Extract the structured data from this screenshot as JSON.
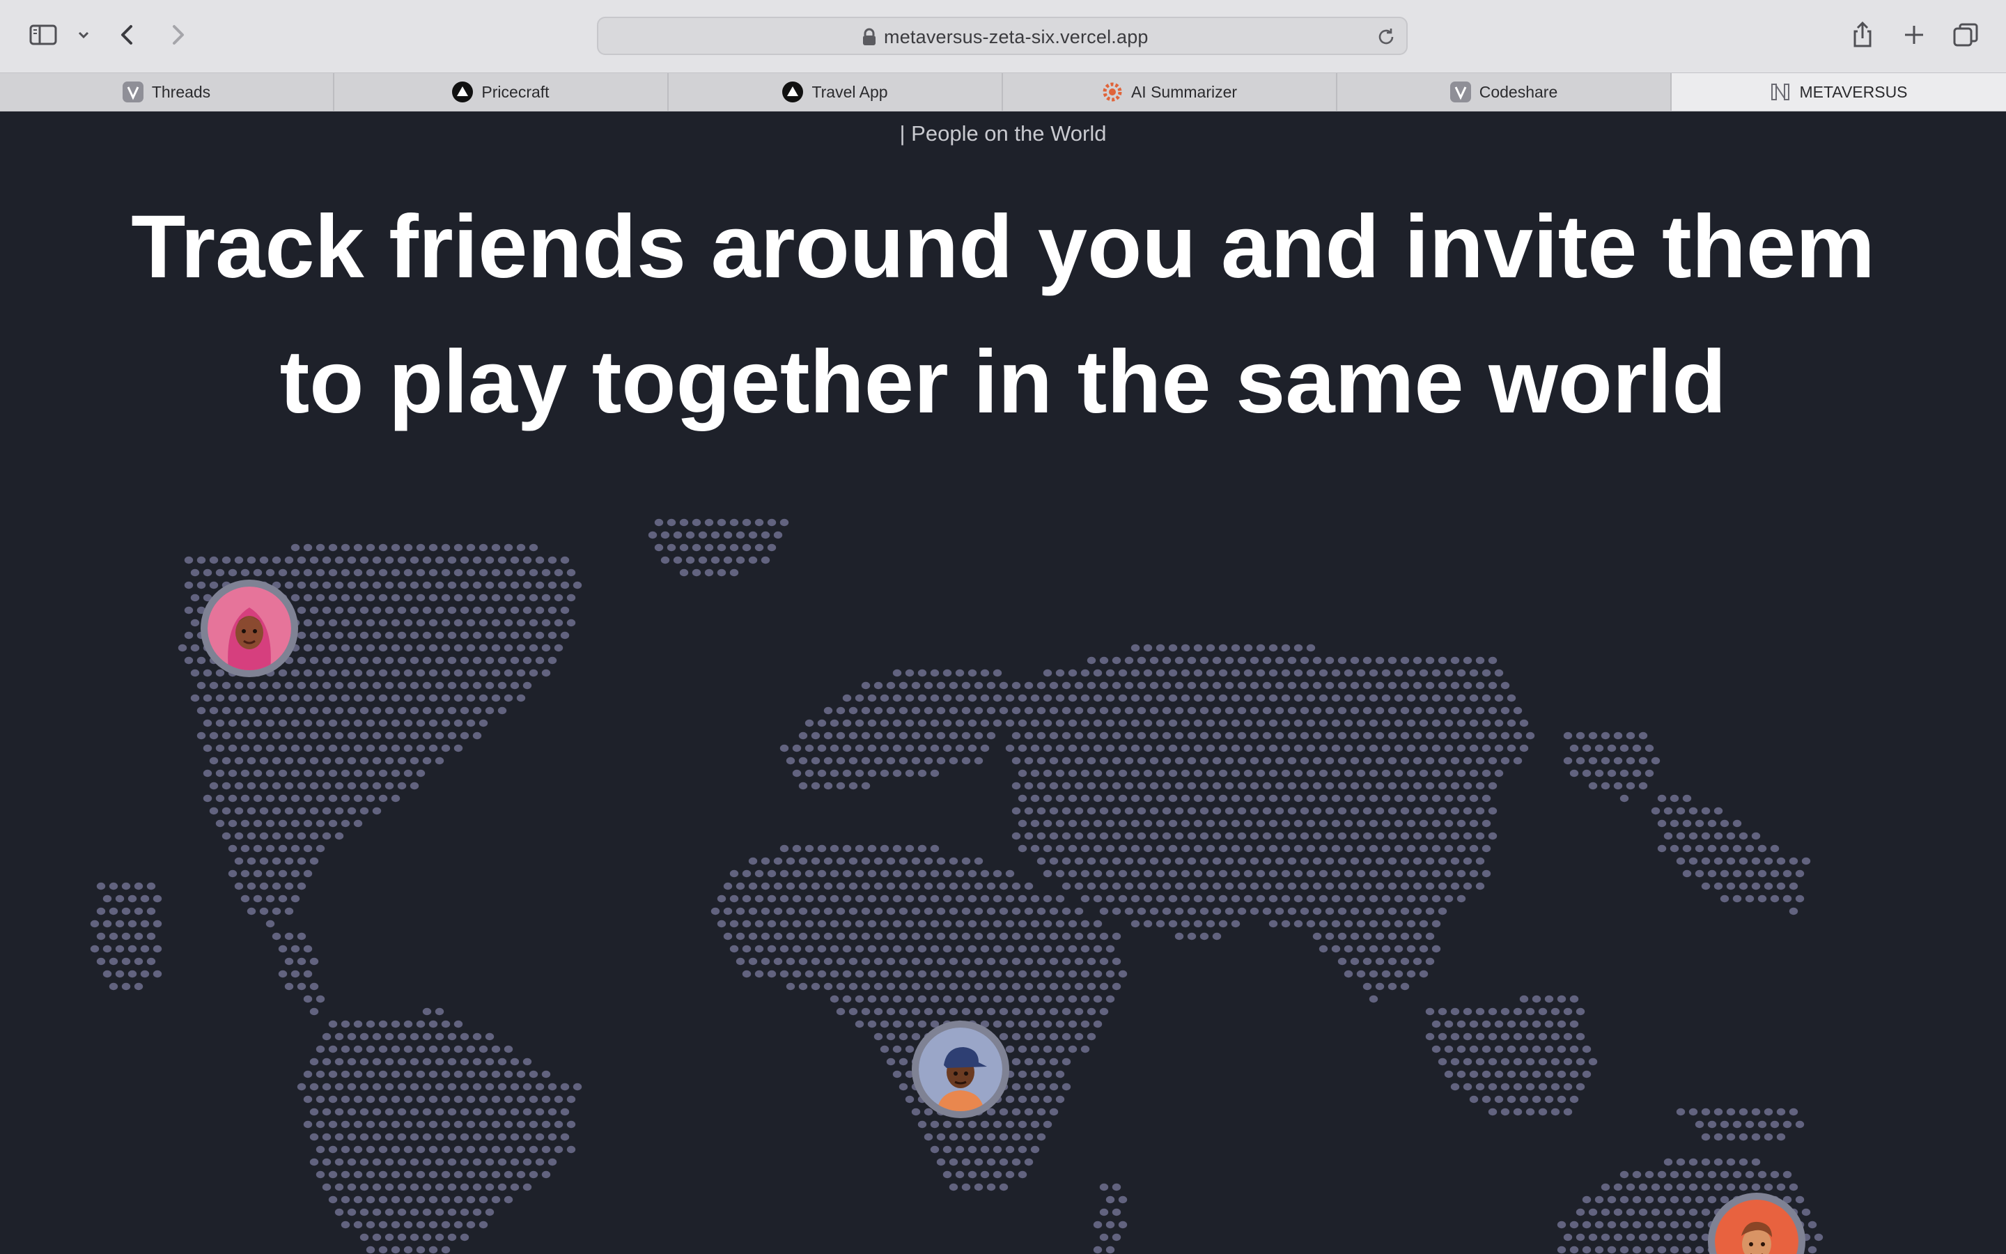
{
  "browser": {
    "url": "metaversus-zeta-six.vercel.app",
    "tabs": [
      {
        "label": "Threads",
        "icon": "v-logo-icon"
      },
      {
        "label": "Pricecraft",
        "icon": "triangle-logo-icon"
      },
      {
        "label": "Travel App",
        "icon": "triangle-logo-icon"
      },
      {
        "label": "AI Summarizer",
        "icon": "gear-logo-icon"
      },
      {
        "label": "Codeshare",
        "icon": "v-logo-icon"
      },
      {
        "label": "METAVERSUS",
        "icon": "metaversus-logo-icon",
        "active": true
      }
    ]
  },
  "section": {
    "eyebrow": "| People on the World",
    "headline_line1": "Track friends around you and invite them",
    "headline_line2": "to play together in the same world"
  },
  "map": {
    "dot_color": "#62637f",
    "background": "#1e212a",
    "avatars": [
      {
        "name": "avatar-north-america",
        "bg": "#e6749a"
      },
      {
        "name": "avatar-africa",
        "bg": "#9aa6c8"
      },
      {
        "name": "avatar-australia",
        "bg": "#e8623f"
      }
    ]
  }
}
